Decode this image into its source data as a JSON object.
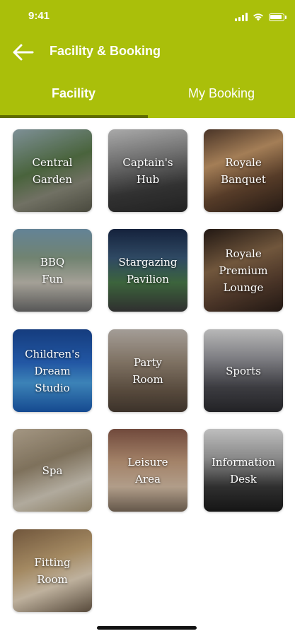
{
  "status": {
    "time": "9:41"
  },
  "nav": {
    "title": "Facility & Booking"
  },
  "tabs": [
    {
      "label": "Facility",
      "active": true
    },
    {
      "label": "My Booking",
      "active": false
    }
  ],
  "colors": {
    "brand": "#aabf0a",
    "tab_indicator": "#5f6b00"
  },
  "facilities": [
    {
      "label": "Central\nGarden",
      "icon": "garden-photo"
    },
    {
      "label": "Captain's\nHub",
      "icon": "lounge-photo"
    },
    {
      "label": "Royale\nBanquet",
      "icon": "banquet-photo"
    },
    {
      "label": "BBQ\nFun",
      "icon": "bbq-photo"
    },
    {
      "label": "Stargazing\nPavilion",
      "icon": "pavilion-photo"
    },
    {
      "label": "Royale\nPremium\nLounge",
      "icon": "premium-lounge-photo"
    },
    {
      "label": "Children's\nDream\nStudio",
      "icon": "pool-photo"
    },
    {
      "label": "Party\nRoom",
      "icon": "party-room-photo"
    },
    {
      "label": "Sports",
      "icon": "sports-photo"
    },
    {
      "label": "Spa",
      "icon": "spa-photo"
    },
    {
      "label": "Leisure\nArea",
      "icon": "leisure-photo"
    },
    {
      "label": "Information\nDesk",
      "icon": "info-desk-photo"
    },
    {
      "label": "Fitting\nRoom",
      "icon": "fitting-room-photo"
    }
  ]
}
